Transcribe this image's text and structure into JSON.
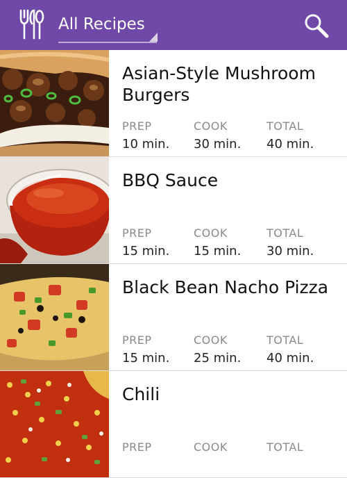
{
  "header": {
    "title": "All Recipes",
    "brand_color": "#7048a7",
    "app_icon": "fork-knife-spoon-icon",
    "search_icon": "search-icon"
  },
  "recipes": [
    {
      "name": "Asian-Style Mushroom Burgers",
      "image": "mushroom-burger-photo",
      "prep_label": "PREP",
      "cook_label": "COOK",
      "total_label": "TOTAL",
      "prep": "10 min.",
      "cook": "30 min.",
      "total": "40 min."
    },
    {
      "name": "BBQ Sauce",
      "image": "bbq-sauce-bowl-photo",
      "prep_label": "PREP",
      "cook_label": "COOK",
      "total_label": "TOTAL",
      "prep": "15 min.",
      "cook": "15 min.",
      "total": "30 min."
    },
    {
      "name": "Black Bean Nacho Pizza",
      "image": "nacho-pizza-photo",
      "prep_label": "PREP",
      "cook_label": "COOK",
      "total_label": "TOTAL",
      "prep": "15 min.",
      "cook": "25 min.",
      "total": "40 min."
    },
    {
      "name": "Chili",
      "image": "chili-photo",
      "prep_label": "PREP",
      "cook_label": "COOK",
      "total_label": "TOTAL",
      "prep": "",
      "cook": "",
      "total": ""
    }
  ]
}
